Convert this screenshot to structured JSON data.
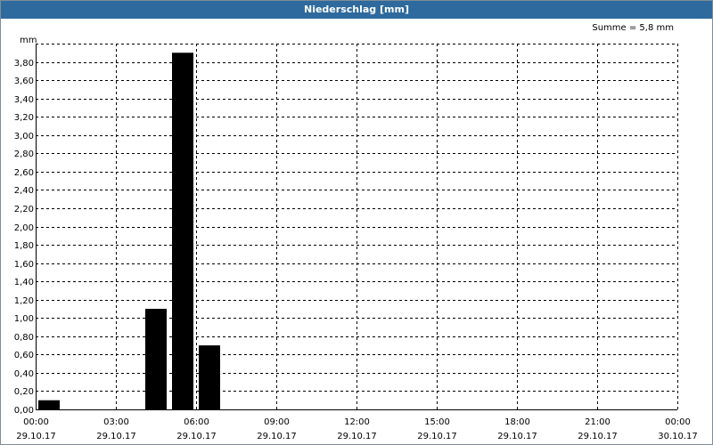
{
  "window": {
    "title": "Niederschlag [mm]"
  },
  "chart_data": {
    "type": "bar",
    "title": "Niederschlag [mm]",
    "ylabel": "mm",
    "annotation": "Summe = 5,8 mm",
    "ylim": [
      0,
      4.0
    ],
    "yticks": [
      "0,00",
      "0,20",
      "0,40",
      "0,60",
      "0,80",
      "1,00",
      "1,20",
      "1,40",
      "1,60",
      "1,80",
      "2,00",
      "2,20",
      "2,40",
      "2,60",
      "2,80",
      "3,00",
      "3,20",
      "3,40",
      "3,60",
      "3,80"
    ],
    "xticks": [
      {
        "time": "00:00",
        "date": "29.10.17"
      },
      {
        "time": "03:00",
        "date": "29.10.17"
      },
      {
        "time": "06:00",
        "date": "29.10.17"
      },
      {
        "time": "09:00",
        "date": "29.10.17"
      },
      {
        "time": "12:00",
        "date": "29.10.17"
      },
      {
        "time": "15:00",
        "date": "29.10.17"
      },
      {
        "time": "18:00",
        "date": "29.10.17"
      },
      {
        "time": "21:00",
        "date": "29.10.17"
      },
      {
        "time": "00:00",
        "date": "30.10.17"
      }
    ],
    "xlim_hours": [
      0,
      24
    ],
    "bars": [
      {
        "start_hour": 0,
        "end_hour": 1,
        "value": 0.1
      },
      {
        "start_hour": 4,
        "end_hour": 5,
        "value": 1.1
      },
      {
        "start_hour": 5,
        "end_hour": 6,
        "value": 3.9
      },
      {
        "start_hour": 6,
        "end_hour": 7,
        "value": 0.7
      }
    ],
    "bar_color": "#000000",
    "grid": true
  }
}
